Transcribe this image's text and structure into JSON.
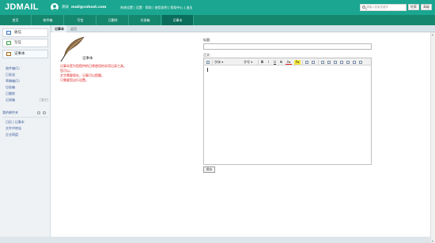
{
  "header": {
    "logo": "JDMAIL",
    "user_name": "测试",
    "user_email": "mail@cnhost.com",
    "links": "系统设置 | 设置 · 帮助 | 使用说明 | 帮助中心 | 退出",
    "search_placeholder": "请输入检索关键字",
    "search_button": "检索",
    "advanced_button": "高级"
  },
  "nav": {
    "items": [
      {
        "label": "首页"
      },
      {
        "label": "收件箱"
      },
      {
        "label": "写信"
      },
      {
        "label": "已删除"
      },
      {
        "label": "垃圾箱"
      },
      {
        "label": "记事本"
      }
    ],
    "active_index": 5
  },
  "sidebar": {
    "inbox": "收信",
    "compose": "写信",
    "notebook": "记事本",
    "folders": [
      {
        "label": "收件箱(1)",
        "count": ""
      },
      {
        "label": "已发送",
        "count": ""
      },
      {
        "label": "草稿箱(1)",
        "count": ""
      },
      {
        "label": "垃圾箱",
        "count": ""
      },
      {
        "label": "已删除",
        "count": ""
      },
      {
        "label": "记录箱",
        "count": "[清空]"
      }
    ],
    "my_folders": "我的邮件夹",
    "extra": [
      {
        "label": "日历 | 记事本"
      },
      {
        "label": "文件中转站"
      },
      {
        "label": "企业网盘"
      }
    ]
  },
  "main": {
    "tab_label": "记事本",
    "tab_back": "返回",
    "notebook_heading": "记事本",
    "description_lines": [
      "记事本是为您提供的日常使用的实用记录工具。",
      "您可以。",
      "文字需要保存，记事可以提醒。",
      "只需要您自行设置。"
    ],
    "title_label": "标题:",
    "content_label": "正文:",
    "title_value": "",
    "font_family_label": "字体",
    "font_size_label": "字号",
    "save_button": "保存"
  },
  "colors": {
    "header": "#1aa690",
    "nav": "#15876e",
    "nav_active": "#0b6d5b",
    "description_text": "#e02020"
  }
}
